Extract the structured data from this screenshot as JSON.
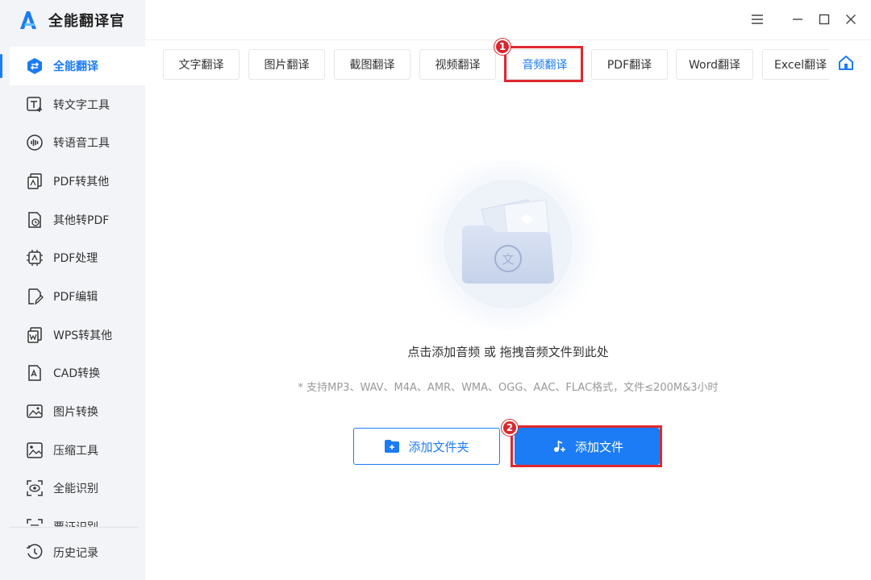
{
  "app": {
    "title": "全能翻译官"
  },
  "sidebar": {
    "items": [
      {
        "label": "全能翻译",
        "icon": "translate-shield-icon",
        "active": true
      },
      {
        "label": "转文字工具",
        "icon": "text-tool-icon"
      },
      {
        "label": "转语音工具",
        "icon": "voice-tool-icon"
      },
      {
        "label": "PDF转其他",
        "icon": "pdf-convert-icon"
      },
      {
        "label": "其他转PDF",
        "icon": "to-pdf-icon"
      },
      {
        "label": "PDF处理",
        "icon": "pdf-process-icon"
      },
      {
        "label": "PDF编辑",
        "icon": "pdf-edit-icon"
      },
      {
        "label": "WPS转其他",
        "icon": "wps-convert-icon"
      },
      {
        "label": "CAD转换",
        "icon": "cad-convert-icon"
      },
      {
        "label": "图片转换",
        "icon": "image-convert-icon"
      },
      {
        "label": "压缩工具",
        "icon": "compress-icon"
      },
      {
        "label": "全能识别",
        "icon": "recognize-icon"
      },
      {
        "label": "票证识别",
        "icon": "ticket-recognize-icon"
      }
    ],
    "history_label": "历史记录"
  },
  "tabs": [
    {
      "label": "文字翻译"
    },
    {
      "label": "图片翻译"
    },
    {
      "label": "截图翻译"
    },
    {
      "label": "视频翻译"
    },
    {
      "label": "音频翻译",
      "active": true
    },
    {
      "label": "PDF翻译"
    },
    {
      "label": "Word翻译"
    },
    {
      "label": "Excel翻译"
    }
  ],
  "markers": {
    "first": "1",
    "second": "2"
  },
  "dropzone": {
    "main_text": "点击添加音频 或 拖拽音频文件到此处",
    "hint": "* 支持MP3、WAV、M4A、AMR、WMA、OGG、AAC、FLAC格式，文件≤200M&3小时"
  },
  "buttons": {
    "add_folder": "添加文件夹",
    "add_file": "添加文件"
  },
  "colors": {
    "accent": "#1b7cf5",
    "highlight": "#e0282e",
    "sidebar_bg": "#f3f4f7"
  }
}
